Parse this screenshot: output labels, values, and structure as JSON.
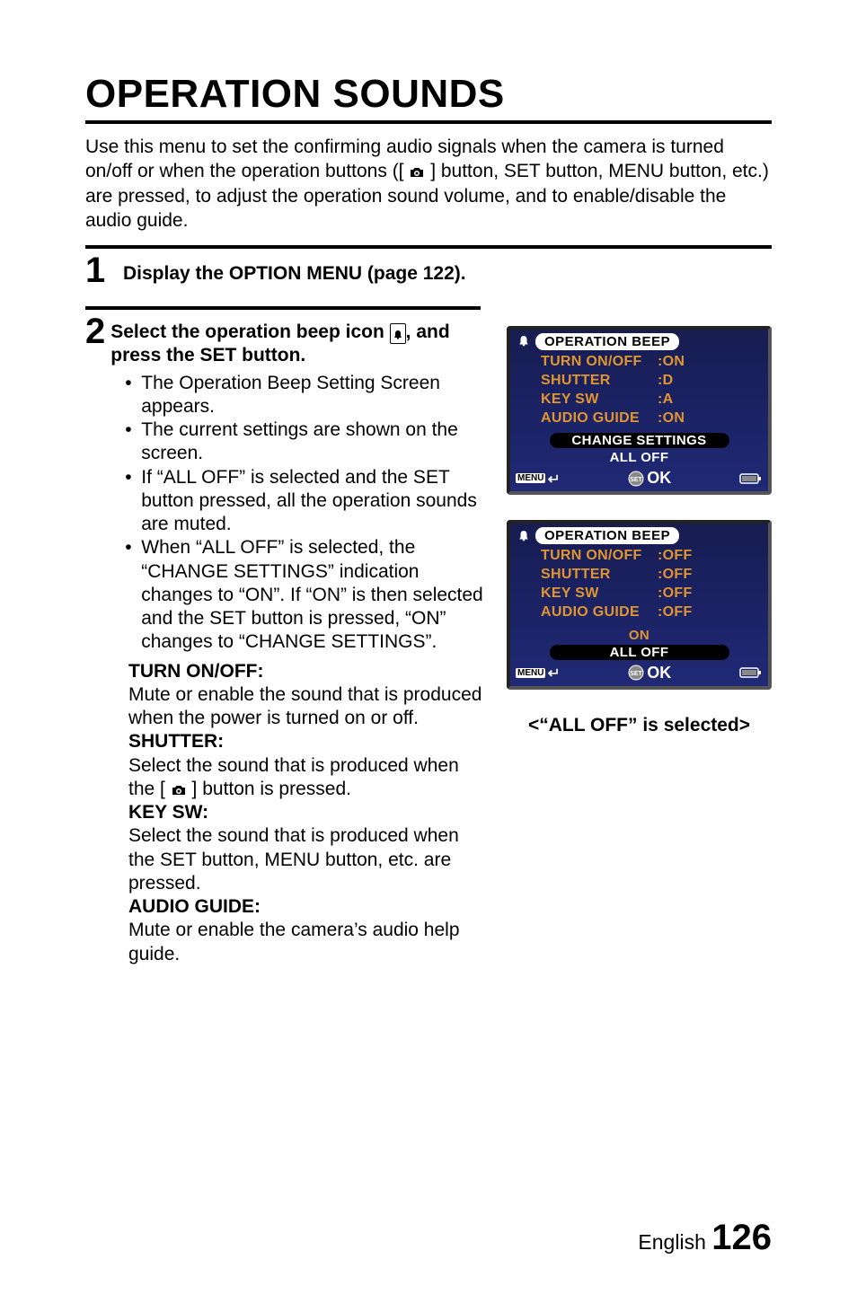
{
  "title": "OPERATION SOUNDS",
  "intro_pre": "Use this menu to set the confirming audio signals when the camera is turned on/off or when the operation buttons ([ ",
  "intro_post": " ] button, SET button, MENU button, etc.) are pressed, to adjust the operation sound volume, and to enable/disable the audio guide.",
  "step1": {
    "num": "1",
    "text": "Display the OPTION MENU (page 122)."
  },
  "step2": {
    "num": "2",
    "heading_pre": "Select the operation beep icon ",
    "heading_post": ", and press the SET button.",
    "bullets": [
      "The Operation Beep Setting Screen appears.",
      "The current settings are shown on the screen.",
      "If “ALL OFF” is selected and the SET button pressed, all the operation sounds are muted.",
      "When “ALL OFF” is selected, the “CHANGE SETTINGS” indication changes to “ON”. If “ON” is then selected and the SET button is pressed, “ON” changes to “CHANGE SETTINGS”."
    ],
    "defs": [
      {
        "term": "TURN ON/OFF:",
        "text": "Mute or enable the sound that is produced when the power is turned on or off."
      },
      {
        "term": "SHUTTER:",
        "text_pre": "Select the sound that is produced when the [ ",
        "text_post": " ] button is pressed."
      },
      {
        "term": "KEY SW:",
        "text": "Select the sound that is produced when the SET button, MENU button, etc. are pressed."
      },
      {
        "term": "AUDIO GUIDE:",
        "text": "Mute or enable the camera’s audio help guide."
      }
    ]
  },
  "lcd1": {
    "header": "OPERATION BEEP",
    "rows": [
      {
        "label": "TURN ON/OFF",
        "val": ":ON"
      },
      {
        "label": "SHUTTER",
        "val": ":D"
      },
      {
        "label": "KEY SW",
        "val": ":A"
      },
      {
        "label": "AUDIO GUIDE",
        "val": ":ON"
      }
    ],
    "btn_selected": "CHANGE SETTINGS",
    "btn_other": "ALL OFF",
    "selected_color": "white",
    "menu": "MENU",
    "ok": "OK"
  },
  "lcd2": {
    "header": "OPERATION BEEP",
    "rows": [
      {
        "label": "TURN ON/OFF",
        "val": ":OFF"
      },
      {
        "label": "SHUTTER",
        "val": ":OFF"
      },
      {
        "label": "KEY SW",
        "val": ":OFF"
      },
      {
        "label": "AUDIO GUIDE",
        "val": ":OFF"
      }
    ],
    "btn_other": "ON",
    "btn_selected": "ALL OFF",
    "selected_color": "white",
    "menu": "MENU",
    "ok": "OK"
  },
  "caption": "<“ALL OFF” is selected>",
  "footer_lang": "English ",
  "footer_page": "126"
}
